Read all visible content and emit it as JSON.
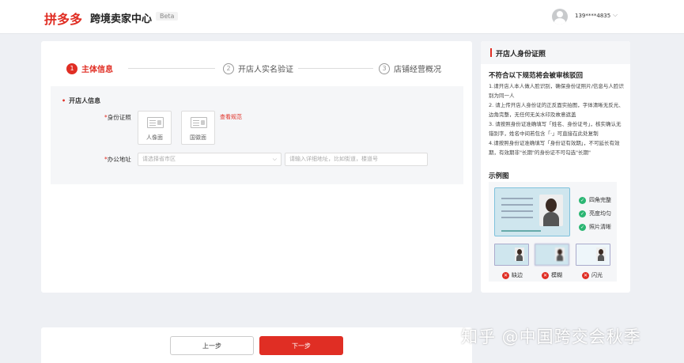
{
  "header": {
    "logo": "拼多多",
    "title": "跨境卖家中心",
    "badge": "Beta",
    "account": "139****4835",
    "chevron_icon": "chevron-down-icon"
  },
  "steps": [
    {
      "num": "1",
      "label": "主体信息",
      "active": true
    },
    {
      "num": "2",
      "label": "开店人实名验证",
      "active": false
    },
    {
      "num": "3",
      "label": "店铺经营概况",
      "active": false
    }
  ],
  "form": {
    "section_title": "开店人信息",
    "id_label_req": "*",
    "id_label": "身份证照",
    "id_front": "人像面",
    "id_back": "国徽面",
    "view_standard": "查看规范",
    "address_label_req": "*",
    "address_label": "办公地址",
    "region_placeholder": "请选择省市区",
    "detail_placeholder": "请输入详细地址，比如街道，楼道号"
  },
  "side": {
    "title": "开店人身份证照",
    "warning_title": "不符合以下规范将会被审核驳回",
    "rules": [
      "1.请开店人本人做人脸识别，确保身份证照片/信息与人脸识别为同一人",
      "2. 请上传开店人身份证的正反面实拍图，字体清晰无反光、边角完整，无任何无关水印及故意遮盖",
      "3. 请按照身份证准确填写「姓名、身份证号」，核实确认无错别字，姓名中间若包含「·」可直接在此处复制",
      "4.请按照身份证准确填写「身份证有效期」，不可延长有效期，有效期非\"长期\"的身份证不可勾选\"长期\""
    ],
    "example_title": "示例图",
    "checks": [
      "四角完整",
      "亮度均匀",
      "照片清晰"
    ],
    "bad_examples": [
      "缺边",
      "模糊",
      "闪光"
    ]
  },
  "footer": {
    "prev": "上一步",
    "next": "下一步"
  },
  "watermark": "知乎 @中国跨交会秋季",
  "colors": {
    "accent": "#e02e24",
    "ok": "#2bb673"
  }
}
